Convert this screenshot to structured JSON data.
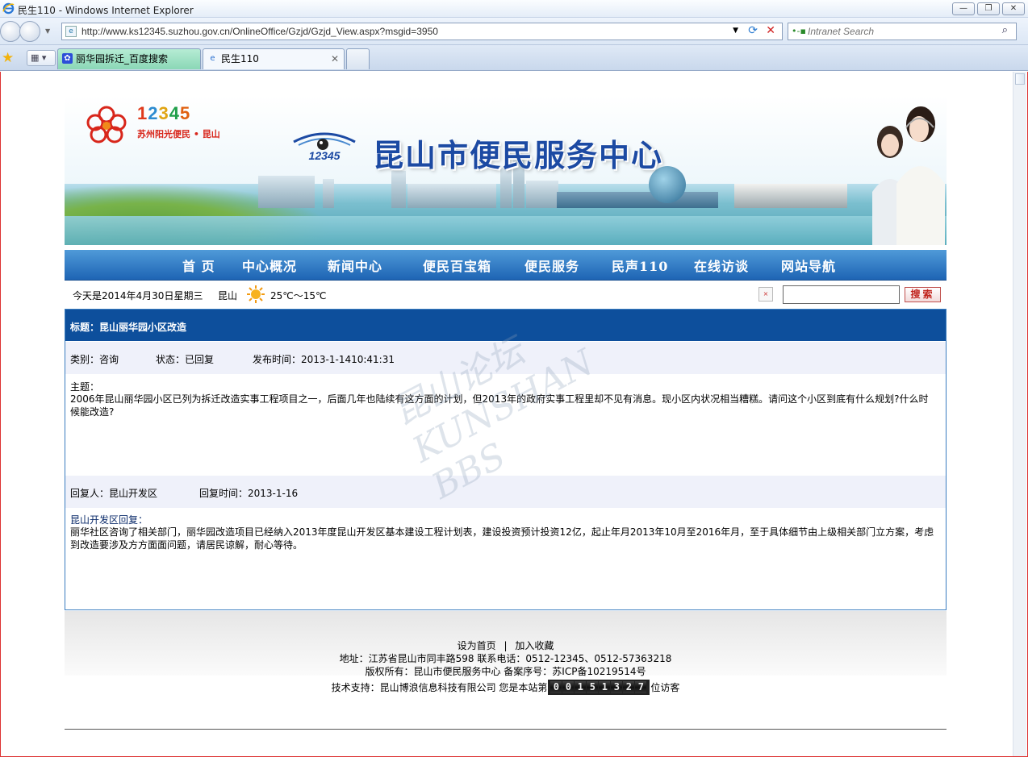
{
  "window": {
    "title": "民生110 - Windows Internet Explorer",
    "controls": [
      "—",
      "❐",
      "✕"
    ]
  },
  "browser": {
    "url": "http://www.ks12345.suzhou.gov.cn/OnlineOffice/Gzjd/Gzjd_View.aspx?msgid=3950",
    "search_placeholder": "Intranet Search",
    "tabs": [
      {
        "label": "丽华园拆迁_百度搜索"
      },
      {
        "label": "民生110"
      }
    ]
  },
  "banner": {
    "logo_number": [
      "1",
      "2",
      "3",
      "4",
      "5"
    ],
    "logo_subtitle": "苏州阳光便民 • 昆山",
    "emblem_text": "12345",
    "title": "昆山市便民服务中心"
  },
  "nav": {
    "items": [
      "首 页",
      "中心概况",
      "新闻中心",
      "便民百宝箱",
      "便民服务",
      "民声110",
      "在线访谈",
      "网站导航"
    ]
  },
  "infobar": {
    "date": "今天是2014年4月30日星期三",
    "city": "昆山",
    "temperature": "25℃～15℃",
    "clear_label": "×",
    "search_button": "搜索"
  },
  "article": {
    "title": "标题：昆山丽华园小区改造",
    "category": "类别：咨询",
    "status": "状态：已回复",
    "published": "发布时间：2013-1-1410:41:31",
    "topic_label": "主题：",
    "topic_text": "2006年昆山丽华园小区已列为拆迁改造实事工程项目之一，后面几年也陆续有这方面的计划，但2013年的政府实事工程里却不见有消息。现小区内状况相当糟糕。请问这个小区到底有什么规划?什么时候能改造?",
    "replier": "回复人：昆山开发区",
    "reply_time": "回复时间：2013-1-16",
    "reply_label": "昆山开发区回复：",
    "reply_text": "丽华社区咨询了相关部门，丽华园改造项目已经纳入2013年度昆山开发区基本建设工程计划表，建设投资预计投资12亿，起止年月2013年10月至2016年月，至于具体细节由上级相关部门立方案，考虑到改造要涉及方方面面问题，请居民谅解，耐心等待。"
  },
  "watermark": "昆山论坛 KUNSHAN BBS",
  "footer": {
    "set_home": "设为首页",
    "separator": "|",
    "add_favorite": "加入收藏",
    "address": "地址：江苏省昆山市同丰路598 联系电话：0512-12345、0512-57363218",
    "copyright": "版权所有：昆山市便民服务中心 备案序号：苏ICP备10219514号",
    "tech_support": "技术支持：昆山博浪信息科技有限公司 您是本站第",
    "visitor_digits": [
      "0",
      "0",
      "1",
      "5",
      "1",
      "3",
      "2",
      "7"
    ],
    "visit_suffix": "位访客"
  }
}
